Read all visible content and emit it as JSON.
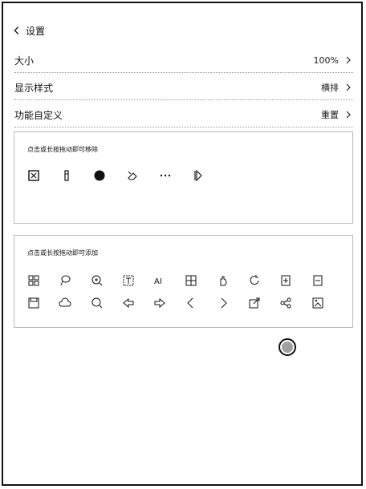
{
  "header": {
    "title": "设置",
    "back_icon": "chevron-left-icon"
  },
  "settings": [
    {
      "label": "大小",
      "value": "100%"
    },
    {
      "label": "显示样式",
      "value": "横排"
    },
    {
      "label": "功能自定义",
      "value": "重置"
    }
  ],
  "panels": {
    "remove_title": "点击或长按拖动即可移除",
    "add_title": "点击或长按拖动即可添加",
    "remove_icons": [
      "frame-select-icon",
      "pen-icon",
      "filled-circle-icon",
      "eraser-icon",
      "more-horizontal-icon",
      "play-toggle-icon"
    ],
    "add_icons_row1": [
      "grid-icon",
      "lasso-icon",
      "zoom-in-icon",
      "text-box-icon",
      "ai-icon",
      "table-icon",
      "hand-icon",
      "refresh-icon",
      "add-page-icon",
      "remove-page-icon"
    ],
    "add_icons_row2": [
      "save-icon",
      "cloud-icon",
      "search-icon",
      "undo-icon",
      "redo-icon",
      "previous-icon",
      "next-icon",
      "export-icon",
      "share-icon",
      "template-icon"
    ],
    "ai_label": "AI"
  },
  "floating_button": {
    "icon": "circle-button-icon"
  }
}
